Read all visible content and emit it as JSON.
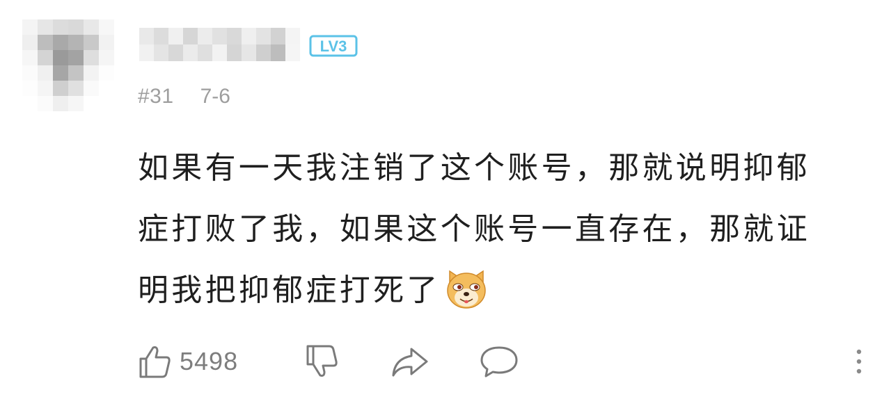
{
  "comment": {
    "level_badge": "LV3",
    "floor": "#31",
    "date": "7-6",
    "lines": [
      "如果有一天我注销了这个账号，那就说明抑郁",
      "症打败了我，如果这个账号一直存在，那就证",
      "明我把抑郁症打死了"
    ],
    "emoji": "doge-emoji",
    "likes": "5498"
  },
  "icons": {
    "like": "thumbs-up-icon",
    "dislike": "thumbs-down-icon",
    "share": "share-arrow-icon",
    "reply": "speech-bubble-icon",
    "more": "vertical-dots-icon"
  },
  "colors": {
    "badge": "#5bc2e7",
    "text": "#1f1f1f",
    "muted": "#9e9e9e",
    "icon": "#7a7a7a"
  }
}
